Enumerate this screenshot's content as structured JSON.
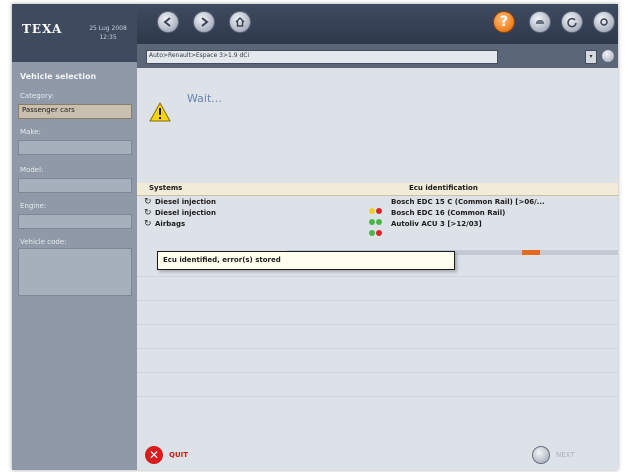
{
  "brand": {
    "logo": "TEXA",
    "date": "25 Lug 2008",
    "time": "12:35"
  },
  "sidebar": {
    "title": "Vehicle selection",
    "category_label": "Category:",
    "category_value": "Passenger cars",
    "make_label": "Make:",
    "model_label": "Model:",
    "engine_label": "Engine:",
    "vehicle_code_label": "Vehicle code:"
  },
  "toolbar": {
    "help_label": "?"
  },
  "path": {
    "value": "Auto>Renault>Espace 3>1.9 dCi"
  },
  "main": {
    "wait_text": "Wait...",
    "columns": {
      "systems": "Systems",
      "ecu": "Ecu identification"
    },
    "rows": [
      {
        "system": "Diesel injection",
        "leds": [
          "#e8d12a",
          "#d9262c"
        ],
        "ecu": "Bosch EDC 15 C (Common Rail) [>06/..."
      },
      {
        "system": "Diesel injection",
        "leds": [
          "#47b548",
          "#47b548"
        ],
        "ecu": "Bosch EDC 16 (Common Rail)"
      },
      {
        "system": "Airbags",
        "leds": [
          "#47b548",
          "#d9262c"
        ],
        "ecu": "Autoliv ACU 3  [>12/03]"
      }
    ],
    "tooltip": "Ecu identified, error(s) stored"
  },
  "footer": {
    "quit_label": "QUIT",
    "next_label": "NEXT"
  },
  "colors": {
    "accent": "#ee7d1c",
    "quit": "#d91c1c",
    "led_green": "#47b548",
    "led_red": "#d9262c",
    "led_yellow": "#e8d12a"
  }
}
